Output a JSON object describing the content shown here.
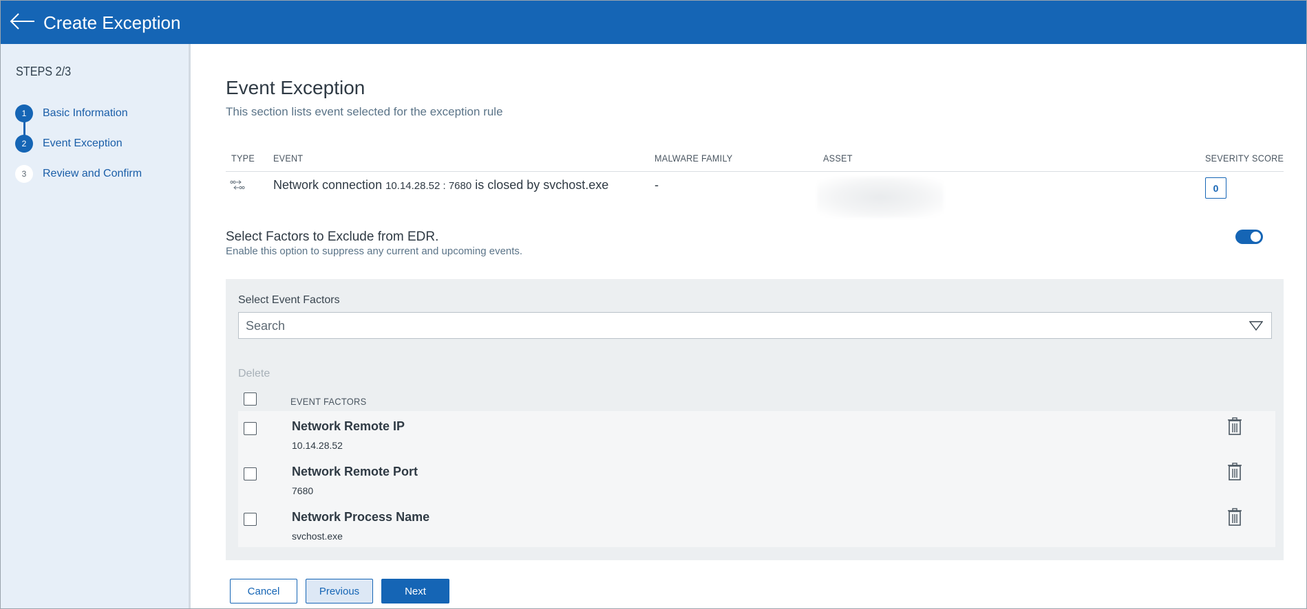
{
  "header": {
    "title": "Create Exception",
    "back_icon": "arrow-left-icon"
  },
  "sidebar": {
    "steps_title": "STEPS 2/3",
    "steps": [
      {
        "number": "1",
        "label": "Basic Information",
        "state": "done"
      },
      {
        "number": "2",
        "label": "Event Exception",
        "state": "current"
      },
      {
        "number": "3",
        "label": "Review and Confirm",
        "state": "todo"
      }
    ]
  },
  "section": {
    "title": "Event Exception",
    "subtitle": "This section lists event selected for the exception rule"
  },
  "event_table": {
    "columns": [
      "TYPE",
      "EVENT",
      "MALWARE FAMILY",
      "ASSET",
      "SEVERITY SCORE"
    ],
    "row": {
      "type_icon": "network-connection-icon",
      "event_prefix": "Network connection ",
      "event_ip_port": "10.14.28.52 : 7680",
      "event_suffix": " is closed by svchost.exe",
      "malware_family": "-",
      "asset": "",
      "severity_score": "0"
    }
  },
  "factors": {
    "title": "Select Factors to Exclude from EDR.",
    "subtitle": "Enable this option to suppress any current and upcoming events.",
    "toggle_on": true,
    "select_label": "Select Event Factors",
    "search_placeholder": "Search",
    "delete_label": "Delete",
    "column_header": "EVENT FACTORS",
    "items": [
      {
        "name": "Network Remote IP",
        "value": "10.14.28.52"
      },
      {
        "name": "Network Remote Port",
        "value": "7680"
      },
      {
        "name": "Network Process Name",
        "value": "svchost.exe"
      }
    ]
  },
  "buttons": {
    "cancel": "Cancel",
    "previous": "Previous",
    "next": "Next"
  },
  "colors": {
    "primary": "#1565b5",
    "sidebar_bg": "#e7eff8",
    "panel_bg": "#eceff1"
  }
}
